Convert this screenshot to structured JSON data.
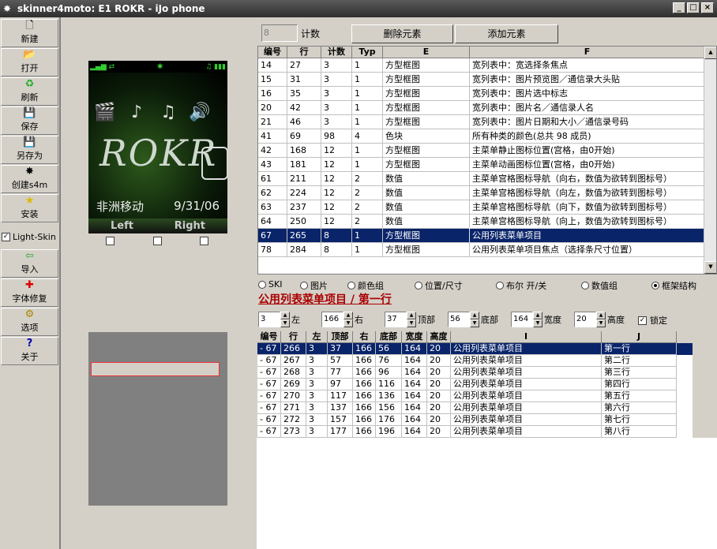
{
  "window": {
    "title": "skinner4moto: E1 ROKR - iJo phone",
    "min": "_",
    "max": "□",
    "close": "×"
  },
  "sidebar": {
    "buttons": [
      {
        "label": "新建",
        "icon": "🗋"
      },
      {
        "label": "打开",
        "icon": "📂"
      },
      {
        "label": "刷新",
        "icon": "♻"
      },
      {
        "label": "保存",
        "icon": "💾"
      },
      {
        "label": "另存为",
        "icon": "💾"
      },
      {
        "label": "创建s4m",
        "icon": "✸"
      },
      {
        "label": "安装",
        "icon": "★"
      },
      {
        "label": "导入",
        "icon": "⇦"
      },
      {
        "label": "字体修复",
        "icon": "✚"
      },
      {
        "label": "选项",
        "icon": "⚙"
      },
      {
        "label": "关于",
        "icon": "?"
      }
    ],
    "light_skin": {
      "label": "Light-Skin",
      "checked": true,
      "mark": "✓"
    }
  },
  "phone": {
    "status_left": "▂▄▆ ⇄",
    "status_mid": "✱",
    "status_right": "♫ ▮▮▮",
    "logo": "ROKR",
    "carrier": "非洲移动",
    "date": "9/31/06",
    "soft_left": "Left",
    "soft_right": "Right",
    "icons": [
      "🎬",
      "♪",
      "♫",
      "🔊"
    ]
  },
  "top": {
    "count_value": "8",
    "count_label": "计数",
    "delete_btn": "删除元素",
    "add_btn": "添加元素"
  },
  "main_table": {
    "columns": [
      "编号",
      "行",
      "计数",
      "Typ",
      "E",
      "F"
    ],
    "rows": [
      [
        "14",
        "27",
        "3",
        "1",
        "方型框图",
        "宽列表中：宽选择条焦点"
      ],
      [
        "15",
        "31",
        "3",
        "1",
        "方型框图",
        "宽列表中：图片预览图／通信录大头贴"
      ],
      [
        "16",
        "35",
        "3",
        "1",
        "方型框图",
        "宽列表中：图片选中标志"
      ],
      [
        "20",
        "42",
        "3",
        "1",
        "方型框图",
        "宽列表中：图片名／通信录人名"
      ],
      [
        "21",
        "46",
        "3",
        "1",
        "方型框图",
        "宽列表中：图片日期和大小／通信录号码"
      ],
      [
        "41",
        "69",
        "98",
        "4",
        "色块",
        "所有种类的颜色(总共 98 成员)"
      ],
      [
        "42",
        "168",
        "12",
        "1",
        "方型框图",
        "主菜单静止图标位置(宫格，由0开始)"
      ],
      [
        "43",
        "181",
        "12",
        "1",
        "方型框图",
        "主菜单动画图标位置(宫格，由0开始)"
      ],
      [
        "61",
        "211",
        "12",
        "2",
        "数值",
        "主菜单宫格图标导航（向右，数值为欲转到图标号）"
      ],
      [
        "62",
        "224",
        "12",
        "2",
        "数值",
        "主菜单宫格图标导航（向左，数值为欲转到图标号）"
      ],
      [
        "63",
        "237",
        "12",
        "2",
        "数值",
        "主菜单宫格图标导航（向下，数值为欲转到图标号）"
      ],
      [
        "64",
        "250",
        "12",
        "2",
        "数值",
        "主菜单宫格图标导航（向上，数值为欲转到图标号）"
      ],
      [
        "67",
        "265",
        "8",
        "1",
        "方型框图",
        "公用列表菜单项目"
      ],
      [
        "78",
        "284",
        "8",
        "1",
        "方型框图",
        "公用列表菜单项目焦点（选择条尺寸位置）"
      ]
    ],
    "selected_index": 12
  },
  "radios": [
    {
      "label": "SKI",
      "on": false
    },
    {
      "label": "图片",
      "on": false
    },
    {
      "label": "颜色组",
      "on": false
    },
    {
      "label": "位置/尺寸",
      "on": false
    },
    {
      "label": "布尔 开/关",
      "on": false
    },
    {
      "label": "数值组",
      "on": false
    },
    {
      "label": "框架结构",
      "on": true
    }
  ],
  "detail_heading": "公用列表菜单项目 / 第一行",
  "spinners": [
    {
      "value": "3",
      "label": "左"
    },
    {
      "value": "166",
      "label": "右"
    },
    {
      "value": "37",
      "label": "顶部"
    },
    {
      "value": "56",
      "label": "底部"
    },
    {
      "value": "164",
      "label": "宽度"
    },
    {
      "value": "20",
      "label": "高度"
    }
  ],
  "lock": {
    "label": "锁定",
    "checked": true,
    "mark": "✓"
  },
  "detail_table": {
    "columns": [
      "编号",
      "行",
      "左",
      "顶部",
      "右",
      "底部",
      "宽度",
      "高度",
      "I",
      "J"
    ],
    "rows": [
      [
        "- 67",
        "266",
        "3",
        "37",
        "166",
        "56",
        "164",
        "20",
        "公用列表菜单项目",
        "第一行"
      ],
      [
        "- 67",
        "267",
        "3",
        "57",
        "166",
        "76",
        "164",
        "20",
        "公用列表菜单项目",
        "第二行"
      ],
      [
        "- 67",
        "268",
        "3",
        "77",
        "166",
        "96",
        "164",
        "20",
        "公用列表菜单项目",
        "第三行"
      ],
      [
        "- 67",
        "269",
        "3",
        "97",
        "166",
        "116",
        "164",
        "20",
        "公用列表菜单项目",
        "第四行"
      ],
      [
        "- 67",
        "270",
        "3",
        "117",
        "166",
        "136",
        "164",
        "20",
        "公用列表菜单项目",
        "第五行"
      ],
      [
        "- 67",
        "271",
        "3",
        "137",
        "166",
        "156",
        "164",
        "20",
        "公用列表菜单项目",
        "第六行"
      ],
      [
        "- 67",
        "272",
        "3",
        "157",
        "166",
        "176",
        "164",
        "20",
        "公用列表菜单项目",
        "第七行"
      ],
      [
        "- 67",
        "273",
        "3",
        "177",
        "166",
        "196",
        "164",
        "20",
        "公用列表菜单项目",
        "第八行"
      ]
    ],
    "selected_index": 0
  },
  "colors": {
    "selection": "#0a246a",
    "heading": "#aa0000"
  }
}
